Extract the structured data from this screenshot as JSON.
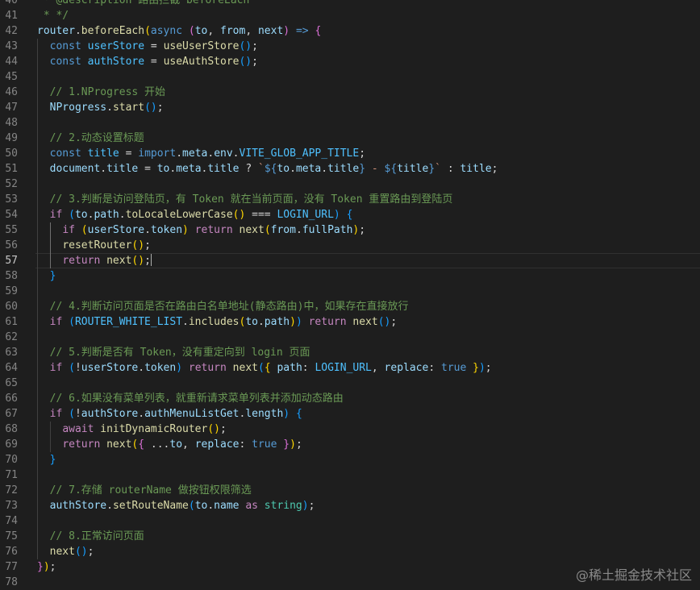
{
  "editor": {
    "active_line": 57,
    "lines": [
      {
        "n": 40,
        "tokens": [
          [
            "cm",
            " * @description 路由拦截 beforeEach"
          ]
        ]
      },
      {
        "n": 41,
        "tokens": [
          [
            "cm",
            " * */"
          ]
        ]
      },
      {
        "n": 42,
        "tokens": [
          [
            "v",
            "router"
          ],
          [
            "p",
            "."
          ],
          [
            "f",
            "beforeEach"
          ],
          [
            "b1",
            "("
          ],
          [
            "k",
            "async"
          ],
          [
            "p",
            " "
          ],
          [
            "b2",
            "("
          ],
          [
            "v",
            "to"
          ],
          [
            "p",
            ", "
          ],
          [
            "v",
            "from"
          ],
          [
            "p",
            ", "
          ],
          [
            "v",
            "next"
          ],
          [
            "b2",
            ")"
          ],
          [
            "p",
            " "
          ],
          [
            "k",
            "=>"
          ],
          [
            "p",
            " "
          ],
          [
            "b2",
            "{"
          ]
        ]
      },
      {
        "n": 43,
        "tokens": [
          [
            "p",
            "  "
          ],
          [
            "k",
            "const"
          ],
          [
            "p",
            " "
          ],
          [
            "kw",
            "userStore"
          ],
          [
            "p",
            " = "
          ],
          [
            "f",
            "useUserStore"
          ],
          [
            "b3",
            "()"
          ],
          [
            "p",
            ";"
          ]
        ]
      },
      {
        "n": 44,
        "tokens": [
          [
            "p",
            "  "
          ],
          [
            "k",
            "const"
          ],
          [
            "p",
            " "
          ],
          [
            "kw",
            "authStore"
          ],
          [
            "p",
            " = "
          ],
          [
            "f",
            "useAuthStore"
          ],
          [
            "b3",
            "()"
          ],
          [
            "p",
            ";"
          ]
        ]
      },
      {
        "n": 45,
        "tokens": []
      },
      {
        "n": 46,
        "tokens": [
          [
            "p",
            "  "
          ],
          [
            "cm",
            "// 1.NProgress 开始"
          ]
        ]
      },
      {
        "n": 47,
        "tokens": [
          [
            "p",
            "  "
          ],
          [
            "v",
            "NProgress"
          ],
          [
            "p",
            "."
          ],
          [
            "f",
            "start"
          ],
          [
            "b3",
            "()"
          ],
          [
            "p",
            ";"
          ]
        ]
      },
      {
        "n": 48,
        "tokens": []
      },
      {
        "n": 49,
        "tokens": [
          [
            "p",
            "  "
          ],
          [
            "cm",
            "// 2.动态设置标题"
          ]
        ]
      },
      {
        "n": 50,
        "tokens": [
          [
            "p",
            "  "
          ],
          [
            "k",
            "const"
          ],
          [
            "p",
            " "
          ],
          [
            "kw",
            "title"
          ],
          [
            "p",
            " = "
          ],
          [
            "k",
            "import"
          ],
          [
            "p",
            "."
          ],
          [
            "v",
            "meta"
          ],
          [
            "p",
            "."
          ],
          [
            "v",
            "env"
          ],
          [
            "p",
            "."
          ],
          [
            "kw",
            "VITE_GLOB_APP_TITLE"
          ],
          [
            "p",
            ";"
          ]
        ]
      },
      {
        "n": 51,
        "tokens": [
          [
            "p",
            "  "
          ],
          [
            "v",
            "document"
          ],
          [
            "p",
            "."
          ],
          [
            "v",
            "title"
          ],
          [
            "p",
            " = "
          ],
          [
            "v",
            "to"
          ],
          [
            "p",
            "."
          ],
          [
            "v",
            "meta"
          ],
          [
            "p",
            "."
          ],
          [
            "v",
            "title"
          ],
          [
            "p",
            " ? "
          ],
          [
            "s",
            "`"
          ],
          [
            "k",
            "${"
          ],
          [
            "v",
            "to"
          ],
          [
            "p",
            "."
          ],
          [
            "v",
            "meta"
          ],
          [
            "p",
            "."
          ],
          [
            "v",
            "title"
          ],
          [
            "k",
            "}"
          ],
          [
            "s",
            " - "
          ],
          [
            "k",
            "${"
          ],
          [
            "v",
            "title"
          ],
          [
            "k",
            "}"
          ],
          [
            "s",
            "`"
          ],
          [
            "p",
            " : "
          ],
          [
            "v",
            "title"
          ],
          [
            "p",
            ";"
          ]
        ]
      },
      {
        "n": 52,
        "tokens": []
      },
      {
        "n": 53,
        "tokens": [
          [
            "p",
            "  "
          ],
          [
            "cm",
            "// 3.判断是访问登陆页，有 Token 就在当前页面，没有 Token 重置路由到登陆页"
          ]
        ]
      },
      {
        "n": 54,
        "tokens": [
          [
            "p",
            "  "
          ],
          [
            "c",
            "if"
          ],
          [
            "p",
            " "
          ],
          [
            "b3",
            "("
          ],
          [
            "v",
            "to"
          ],
          [
            "p",
            "."
          ],
          [
            "v",
            "path"
          ],
          [
            "p",
            "."
          ],
          [
            "f",
            "toLocaleLowerCase"
          ],
          [
            "b1",
            "()"
          ],
          [
            "p",
            " === "
          ],
          [
            "kw",
            "LOGIN_URL"
          ],
          [
            "b3",
            ")"
          ],
          [
            "p",
            " "
          ],
          [
            "b3",
            "{"
          ]
        ]
      },
      {
        "n": 55,
        "tokens": [
          [
            "p",
            "    "
          ],
          [
            "c",
            "if"
          ],
          [
            "p",
            " "
          ],
          [
            "b1",
            "("
          ],
          [
            "v",
            "userStore"
          ],
          [
            "p",
            "."
          ],
          [
            "v",
            "token"
          ],
          [
            "b1",
            ")"
          ],
          [
            "p",
            " "
          ],
          [
            "c",
            "return"
          ],
          [
            "p",
            " "
          ],
          [
            "f",
            "next"
          ],
          [
            "b1",
            "("
          ],
          [
            "v",
            "from"
          ],
          [
            "p",
            "."
          ],
          [
            "v",
            "fullPath"
          ],
          [
            "b1",
            ")"
          ],
          [
            "p",
            ";"
          ]
        ]
      },
      {
        "n": 56,
        "tokens": [
          [
            "p",
            "    "
          ],
          [
            "f",
            "resetRouter"
          ],
          [
            "b1",
            "()"
          ],
          [
            "p",
            ";"
          ]
        ]
      },
      {
        "n": 57,
        "tokens": [
          [
            "p",
            "    "
          ],
          [
            "c",
            "return"
          ],
          [
            "p",
            " "
          ],
          [
            "f",
            "next"
          ],
          [
            "b1",
            "()"
          ],
          [
            "p",
            ";"
          ]
        ]
      },
      {
        "n": 58,
        "tokens": [
          [
            "p",
            "  "
          ],
          [
            "b3",
            "}"
          ]
        ]
      },
      {
        "n": 59,
        "tokens": []
      },
      {
        "n": 60,
        "tokens": [
          [
            "p",
            "  "
          ],
          [
            "cm",
            "// 4.判断访问页面是否在路由白名单地址(静态路由)中，如果存在直接放行"
          ]
        ]
      },
      {
        "n": 61,
        "tokens": [
          [
            "p",
            "  "
          ],
          [
            "c",
            "if"
          ],
          [
            "p",
            " "
          ],
          [
            "b3",
            "("
          ],
          [
            "kw",
            "ROUTER_WHITE_LIST"
          ],
          [
            "p",
            "."
          ],
          [
            "f",
            "includes"
          ],
          [
            "b1",
            "("
          ],
          [
            "v",
            "to"
          ],
          [
            "p",
            "."
          ],
          [
            "v",
            "path"
          ],
          [
            "b1",
            ")"
          ],
          [
            "b3",
            ")"
          ],
          [
            "p",
            " "
          ],
          [
            "c",
            "return"
          ],
          [
            "p",
            " "
          ],
          [
            "f",
            "next"
          ],
          [
            "b3",
            "()"
          ],
          [
            "p",
            ";"
          ]
        ]
      },
      {
        "n": 62,
        "tokens": []
      },
      {
        "n": 63,
        "tokens": [
          [
            "p",
            "  "
          ],
          [
            "cm",
            "// 5.判断是否有 Token，没有重定向到 login 页面"
          ]
        ]
      },
      {
        "n": 64,
        "tokens": [
          [
            "p",
            "  "
          ],
          [
            "c",
            "if"
          ],
          [
            "p",
            " "
          ],
          [
            "b3",
            "("
          ],
          [
            "p",
            "!"
          ],
          [
            "v",
            "userStore"
          ],
          [
            "p",
            "."
          ],
          [
            "v",
            "token"
          ],
          [
            "b3",
            ")"
          ],
          [
            "p",
            " "
          ],
          [
            "c",
            "return"
          ],
          [
            "p",
            " "
          ],
          [
            "f",
            "next"
          ],
          [
            "b3",
            "("
          ],
          [
            "b1",
            "{"
          ],
          [
            "p",
            " "
          ],
          [
            "v",
            "path"
          ],
          [
            "p",
            ": "
          ],
          [
            "kw",
            "LOGIN_URL"
          ],
          [
            "p",
            ", "
          ],
          [
            "v",
            "replace"
          ],
          [
            "p",
            ": "
          ],
          [
            "k",
            "true"
          ],
          [
            "p",
            " "
          ],
          [
            "b1",
            "}"
          ],
          [
            "b3",
            ")"
          ],
          [
            "p",
            ";"
          ]
        ]
      },
      {
        "n": 65,
        "tokens": []
      },
      {
        "n": 66,
        "tokens": [
          [
            "p",
            "  "
          ],
          [
            "cm",
            "// 6.如果没有菜单列表，就重新请求菜单列表并添加动态路由"
          ]
        ]
      },
      {
        "n": 67,
        "tokens": [
          [
            "p",
            "  "
          ],
          [
            "c",
            "if"
          ],
          [
            "p",
            " "
          ],
          [
            "b3",
            "("
          ],
          [
            "p",
            "!"
          ],
          [
            "v",
            "authStore"
          ],
          [
            "p",
            "."
          ],
          [
            "v",
            "authMenuListGet"
          ],
          [
            "p",
            "."
          ],
          [
            "v",
            "length"
          ],
          [
            "b3",
            ")"
          ],
          [
            "p",
            " "
          ],
          [
            "b3",
            "{"
          ]
        ]
      },
      {
        "n": 68,
        "tokens": [
          [
            "p",
            "    "
          ],
          [
            "c",
            "await"
          ],
          [
            "p",
            " "
          ],
          [
            "f",
            "initDynamicRouter"
          ],
          [
            "b1",
            "()"
          ],
          [
            "p",
            ";"
          ]
        ]
      },
      {
        "n": 69,
        "tokens": [
          [
            "p",
            "    "
          ],
          [
            "c",
            "return"
          ],
          [
            "p",
            " "
          ],
          [
            "f",
            "next"
          ],
          [
            "b1",
            "("
          ],
          [
            "b2",
            "{"
          ],
          [
            "p",
            " ..."
          ],
          [
            "v",
            "to"
          ],
          [
            "p",
            ", "
          ],
          [
            "v",
            "replace"
          ],
          [
            "p",
            ": "
          ],
          [
            "k",
            "true"
          ],
          [
            "p",
            " "
          ],
          [
            "b2",
            "}"
          ],
          [
            "b1",
            ")"
          ],
          [
            "p",
            ";"
          ]
        ]
      },
      {
        "n": 70,
        "tokens": [
          [
            "p",
            "  "
          ],
          [
            "b3",
            "}"
          ]
        ]
      },
      {
        "n": 71,
        "tokens": []
      },
      {
        "n": 72,
        "tokens": [
          [
            "p",
            "  "
          ],
          [
            "cm",
            "// 7.存储 routerName 做按钮权限筛选"
          ]
        ]
      },
      {
        "n": 73,
        "tokens": [
          [
            "p",
            "  "
          ],
          [
            "v",
            "authStore"
          ],
          [
            "p",
            "."
          ],
          [
            "f",
            "setRouteName"
          ],
          [
            "b3",
            "("
          ],
          [
            "v",
            "to"
          ],
          [
            "p",
            "."
          ],
          [
            "v",
            "name"
          ],
          [
            "p",
            " "
          ],
          [
            "c",
            "as"
          ],
          [
            "p",
            " "
          ],
          [
            "t",
            "string"
          ],
          [
            "b3",
            ")"
          ],
          [
            "p",
            ";"
          ]
        ]
      },
      {
        "n": 74,
        "tokens": []
      },
      {
        "n": 75,
        "tokens": [
          [
            "p",
            "  "
          ],
          [
            "cm",
            "// 8.正常访问页面"
          ]
        ]
      },
      {
        "n": 76,
        "tokens": [
          [
            "p",
            "  "
          ],
          [
            "f",
            "next"
          ],
          [
            "b3",
            "()"
          ],
          [
            "p",
            ";"
          ]
        ]
      },
      {
        "n": 77,
        "tokens": [
          [
            "b2",
            "}"
          ],
          [
            "b1",
            ")"
          ],
          [
            "p",
            ";"
          ]
        ]
      },
      {
        "n": 78,
        "tokens": []
      }
    ]
  },
  "watermark": "@稀土掘金技术社区"
}
